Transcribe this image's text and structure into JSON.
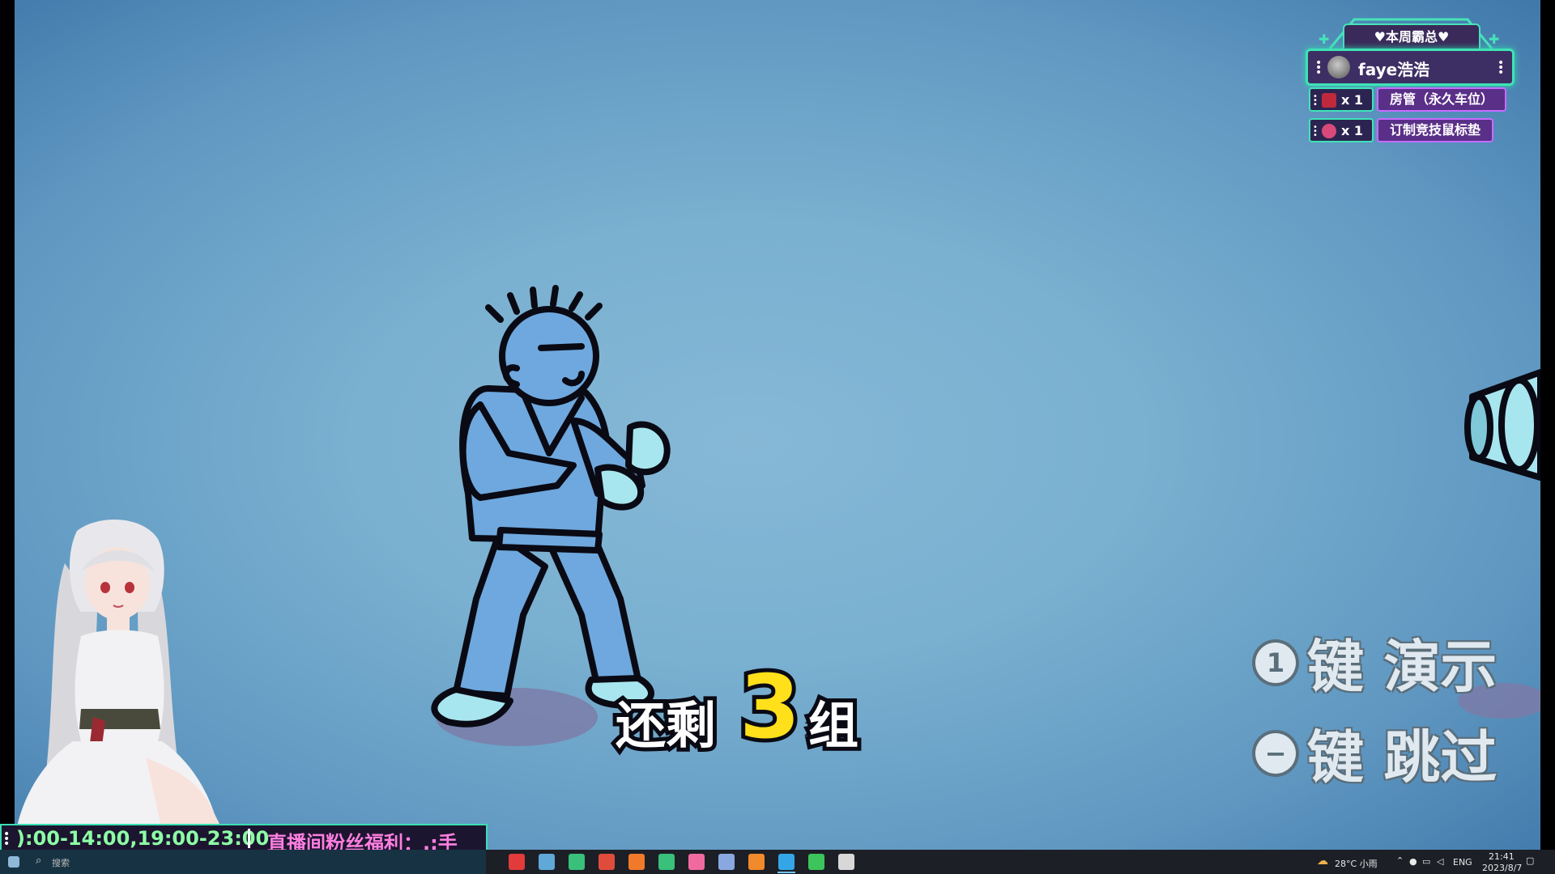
{
  "game": {
    "remaining": {
      "prefix": "还剩",
      "count": "3",
      "suffix": "组"
    },
    "hints": [
      {
        "key": "1",
        "action": "键 演示"
      },
      {
        "key": "−",
        "action": "键 跳过"
      }
    ]
  },
  "leaderboard": {
    "title": "♥本周霸总♥",
    "top_user": "faye浩浩",
    "rewards": [
      {
        "count": "x 1",
        "label": "房管（永久车位）",
        "color": "#c0283c"
      },
      {
        "count": "x 1",
        "label": "订制竞技鼠标垫",
        "color": "#d94a7a"
      }
    ]
  },
  "ticker": {
    "hours": "):00-14:00,19:00-23:00",
    "message": "直播间粉丝福利：.:手"
  },
  "taskbar": {
    "search_label": "搜索",
    "apps": [
      {
        "name": "app-icon-1",
        "color": "#e23b3b"
      },
      {
        "name": "steam-icon",
        "color": "#5fa8d8"
      },
      {
        "name": "app-icon-3",
        "color": "#39c07a"
      },
      {
        "name": "app-icon-4",
        "color": "#e04c3c"
      },
      {
        "name": "app-icon-5",
        "color": "#f07a2a"
      },
      {
        "name": "app-icon-6",
        "color": "#39c07a"
      },
      {
        "name": "app-icon-7",
        "color": "#f06aa0"
      },
      {
        "name": "app-icon-8",
        "color": "#8aa8e0"
      },
      {
        "name": "app-icon-9",
        "color": "#f08a2a"
      },
      {
        "name": "app-icon-10",
        "color": "#34a6e8"
      },
      {
        "name": "wechat-icon",
        "color": "#3cc55a"
      },
      {
        "name": "settings-icon",
        "color": "#d8d8d8"
      }
    ],
    "weather": "28°C 小雨",
    "language": "ENG",
    "time": "21:41",
    "date": "2023/8/7"
  }
}
